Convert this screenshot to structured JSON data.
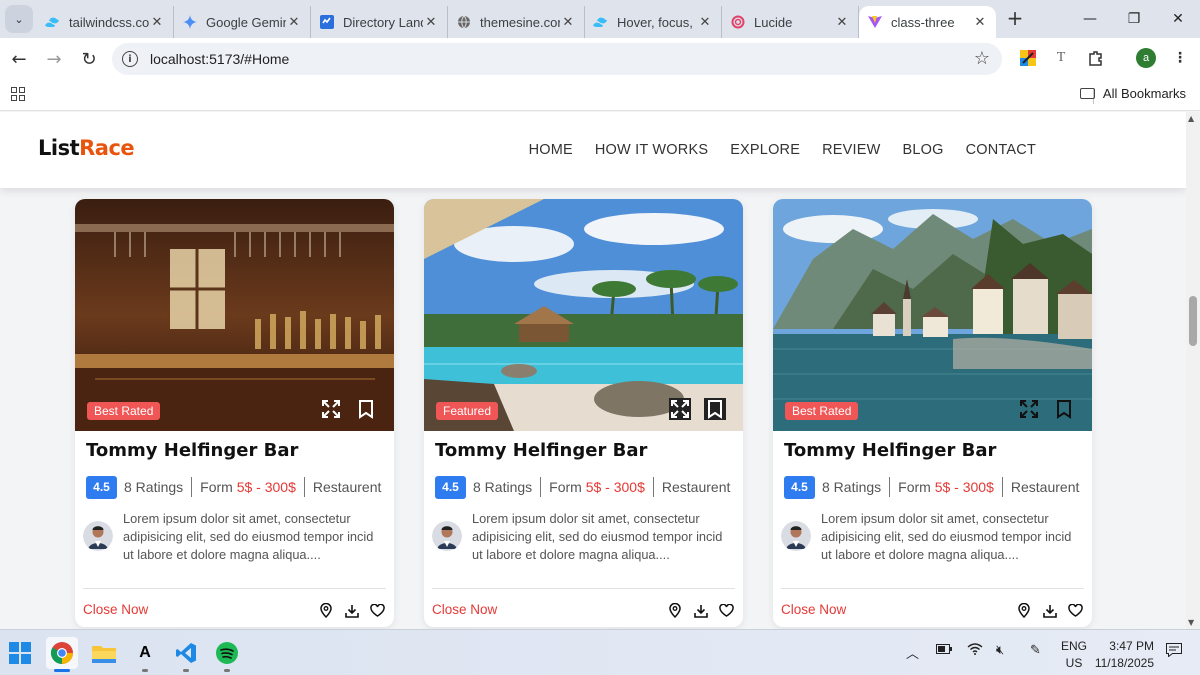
{
  "browser": {
    "tabs": [
      {
        "label": "tailwindcss.com",
        "icon": "tailwind-icon",
        "active": false
      },
      {
        "label": "Google Gemini",
        "icon": "gemini-icon",
        "active": false
      },
      {
        "label": "Directory Landing",
        "icon": "directory-icon",
        "active": false
      },
      {
        "label": "themesine.com",
        "icon": "globe-icon",
        "active": false
      },
      {
        "label": "Hover, focus, and other states",
        "icon": "tailwind-icon",
        "active": false
      },
      {
        "label": "Lucide",
        "icon": "lucide-icon",
        "active": false
      },
      {
        "label": "class-three",
        "icon": "vite-icon",
        "active": true
      }
    ],
    "url": "localhost:5173/#Home",
    "bookmarks_label": "All Bookmarks",
    "profile_initial": "a"
  },
  "site": {
    "logo_main": "List",
    "logo_accent": "Race",
    "accent_color": "#e8540e",
    "nav": [
      "HOME",
      "HOW IT WORKS",
      "EXPLORE",
      "REVIEW",
      "BLOG",
      "CONTACT"
    ]
  },
  "listings": [
    {
      "image": "bar-interior-photo",
      "badge": "Best Rated",
      "title": "Tommy Helfinger Bar",
      "rating": "4.5",
      "ratings_count": "8 Ratings",
      "price_prefix": "Form",
      "price": "5$ - 300$",
      "category": "Restaurent",
      "description": "Lorem ipsum dolor sit amet, consectetur adipisicing elit, sed do eiusmod tempor incid ut labore et dolore magna aliqua....",
      "action": "Close Now"
    },
    {
      "image": "resort-pool-photo",
      "badge": "Featured",
      "title": "Tommy Helfinger Bar",
      "rating": "4.5",
      "ratings_count": "8 Ratings",
      "price_prefix": "Form",
      "price": "5$ - 300$",
      "category": "Restaurent",
      "description": "Lorem ipsum dolor sit amet, consectetur adipisicing elit, sed do eiusmod tempor incid ut labore et dolore magna aliqua....",
      "action": "Close Now"
    },
    {
      "image": "mountain-lake-village-photo",
      "badge": "Best Rated",
      "title": "Tommy Helfinger Bar",
      "rating": "4.5",
      "ratings_count": "8 Ratings",
      "price_prefix": "Form",
      "price": "5$ - 300$",
      "category": "Restaurent",
      "description": "Lorem ipsum dolor sit amet, consectetur adipisicing elit, sed do eiusmod tempor incid ut labore et dolore magna aliqua....",
      "action": "Close Now"
    }
  ],
  "taskbar": {
    "apps": [
      "windows-start-icon",
      "chrome-icon",
      "file-explorer-icon",
      "font-app-icon",
      "vscode-icon",
      "spotify-icon"
    ],
    "language": "ENG",
    "region": "US",
    "time": "3:47 PM",
    "date": "11/18/2025"
  }
}
